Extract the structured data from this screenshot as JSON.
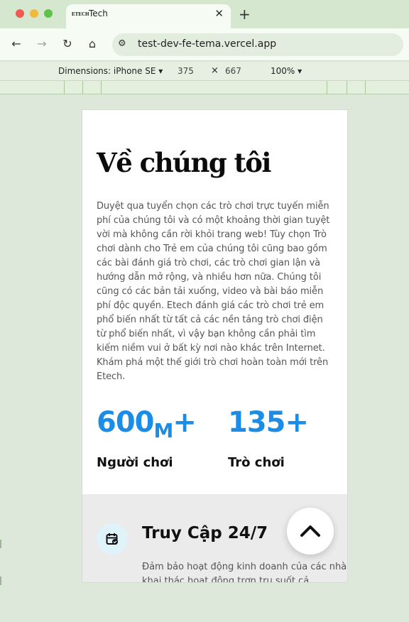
{
  "browser": {
    "tab_title": "Tech",
    "favicon_text": "ETECH",
    "url": "test-dev-fe-tema.vercel.app"
  },
  "devtools": {
    "device": "Dimensions: iPhone SE ▾",
    "width": "375",
    "height": "667",
    "zoom": "100% ▾"
  },
  "about": {
    "title": "Về chúng tôi",
    "description": "Duyệt qua tuyển chọn các trò chơi trực tuyến miễn phí của chúng tôi và có một khoảng thời gian tuyệt vời mà không cần rời khỏi trang web! Tùy chọn Trò chơi dành cho Trẻ em của chúng tôi cũng bao gồm các bài đánh giá trò chơi, các trò chơi gian lận và hướng dẫn mở rộng, và nhiều hơn nữa. Chúng tôi cũng có các bản tải xuống, video và bài báo miễn phí độc quyền. Etech đánh giá các trò chơi trẻ em phổ biến nhất từ tất cả các nền tảng trò chơi điện từ phổ biến nhất, vì vậy bạn không cần phải tìm kiếm niềm vui ở bất kỳ nơi nào khác trên Internet. Khám phá một thế giới trò chơi hoàn toàn mới trên Etech.",
    "stats": [
      {
        "number": "600",
        "unit": "M",
        "suffix": "+",
        "label": "Người chơi"
      },
      {
        "number": "135",
        "unit": "",
        "suffix": "+",
        "label": "Trò chơi"
      }
    ]
  },
  "feature": {
    "icon": "calendar-check-icon",
    "title": "Truy Cập 24/7",
    "description": "Đảm bảo hoạt động kinh doanh của các nhà khai thác hoạt động trơn tru suốt cả"
  },
  "colors": {
    "accent": "#1b8de6",
    "icon_bg": "#dff3fb",
    "feature_bg": "#ebebeb"
  }
}
